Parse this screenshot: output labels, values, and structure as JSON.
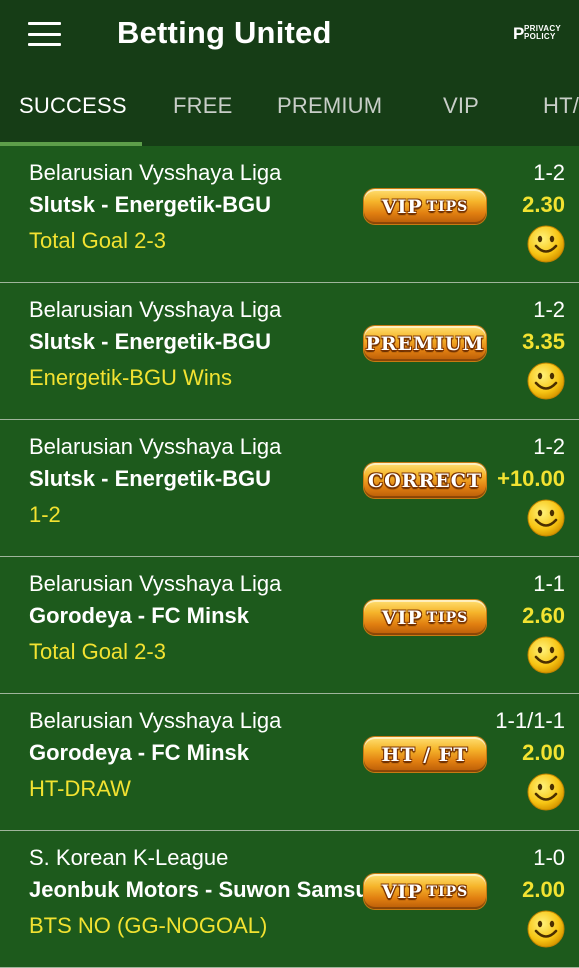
{
  "appbar": {
    "title": "Betting United",
    "privacy_top": "PRIVACY",
    "privacy_bottom": "POLICY",
    "privacy_letter": "P"
  },
  "tabs": [
    {
      "label": "SUCCESS",
      "active": true
    },
    {
      "label": "FREE",
      "active": false
    },
    {
      "label": "PREMIUM",
      "active": false
    },
    {
      "label": "VIP",
      "active": false
    },
    {
      "label": "HT/",
      "active": false
    }
  ],
  "rows": [
    {
      "league": "Belarusian Vysshaya Liga",
      "match": "Slutsk - Energetik-BGU",
      "tip": "Total Goal 2-3",
      "score": "1-2",
      "odds": "2.30",
      "badge_main": "VIP",
      "badge_small": "TIPS"
    },
    {
      "league": "Belarusian Vysshaya Liga",
      "match": "Slutsk - Energetik-BGU",
      "tip": "Energetik-BGU Wins",
      "score": "1-2",
      "odds": "3.35",
      "badge_main": "PREMIUM",
      "badge_small": ""
    },
    {
      "league": "Belarusian Vysshaya Liga",
      "match": "Slutsk - Energetik-BGU",
      "tip": "1-2",
      "score": "1-2",
      "odds": "+10.00",
      "badge_main": "CORRECT",
      "badge_small": ""
    },
    {
      "league": "Belarusian Vysshaya Liga",
      "match": "Gorodeya - FC Minsk",
      "tip": "Total Goal 2-3",
      "score": "1-1",
      "odds": "2.60",
      "badge_main": "VIP",
      "badge_small": "TIPS"
    },
    {
      "league": "Belarusian Vysshaya Liga",
      "match": "Gorodeya - FC Minsk",
      "tip": "HT-DRAW",
      "score": "1-1/1-1",
      "odds": "2.00",
      "badge_main": "HT / FT",
      "badge_small": ""
    },
    {
      "league": "S. Korean K-League",
      "match": "Jeonbuk Motors - Suwon Samsung",
      "tip": "BTS NO (GG-NOGOAL)",
      "score": "1-0",
      "odds": "2.00",
      "badge_main": "VIP",
      "badge_small": "TIPS"
    }
  ],
  "colors": {
    "background": "#1d5a1c",
    "header": "#163d16",
    "accent_yellow": "#f2e231",
    "indicator": "#5d9e4a"
  },
  "icons": {
    "menu": "hamburger-menu-icon",
    "result": "smiley-face-icon"
  }
}
